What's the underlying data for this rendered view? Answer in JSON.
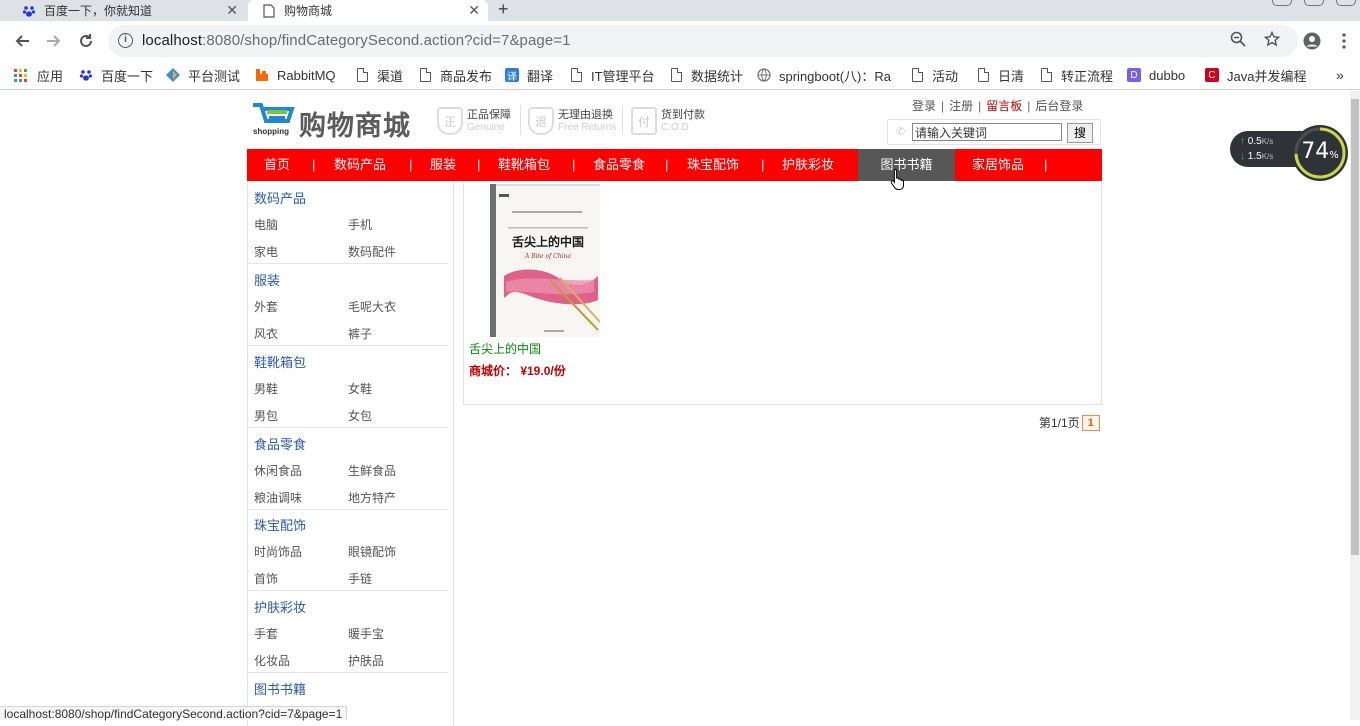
{
  "browser": {
    "tabs": [
      {
        "title": "百度一下，你就知道",
        "active": false
      },
      {
        "title": "购物商城",
        "active": true
      }
    ],
    "url_host": "localhost",
    "url_path": ":8080/shop/findCategorySecond.action?cid=7&page=1",
    "bookmarks": [
      "应用",
      "百度一下",
      "平台测试",
      "RabbitMQ",
      "渠道",
      "商品发布",
      "翻译",
      "IT管理平台",
      "数据统计",
      "springboot(八)：Ra",
      "活动",
      "日清",
      "转正流程",
      "dubbo",
      "Java并发编程"
    ],
    "status_url": "localhost:8080/shop/findCategorySecond.action?cid=7&page=1"
  },
  "header": {
    "logo_title": "购物商城",
    "logo_sub": "shopping",
    "promises": [
      {
        "title": "正品保障",
        "sub": "Genuine",
        "icon": "正"
      },
      {
        "title": "无理由退换",
        "sub": "Free Returns",
        "icon": "退"
      },
      {
        "title": "货到付款",
        "sub": "C.O.D",
        "icon": "付"
      }
    ],
    "links": {
      "login": "登录",
      "register": "注册",
      "guestbook": "留言板",
      "admin": "后台登录",
      "sep": "|"
    },
    "search": {
      "value": "请输入关键词",
      "button": "搜"
    }
  },
  "nav": {
    "items": [
      "首页",
      "数码产品",
      "服装",
      "鞋靴箱包",
      "食品零食",
      "珠宝配饰",
      "护肤彩妆",
      "图书书籍",
      "家居饰品"
    ],
    "active": "图书书籍",
    "pipe": "|"
  },
  "sidebar": {
    "categories": [
      {
        "title": "数码产品",
        "items": [
          "电脑",
          "手机",
          "家电",
          "数码配件"
        ]
      },
      {
        "title": "服装",
        "items": [
          "外套",
          "毛呢大衣",
          "风衣",
          "裤子"
        ]
      },
      {
        "title": "鞋靴箱包",
        "items": [
          "男鞋",
          "女鞋",
          "男包",
          "女包"
        ]
      },
      {
        "title": "食品零食",
        "items": [
          "休闲食品",
          "生鲜食品",
          "粮油调味",
          "地方特产"
        ]
      },
      {
        "title": "珠宝配饰",
        "items": [
          "时尚饰品",
          "眼镜配饰",
          "首饰",
          "手链"
        ]
      },
      {
        "title": "护肤彩妆",
        "items": [
          "手套",
          "暖手宝",
          "化妆品",
          "护肤品"
        ]
      },
      {
        "title": "图书书籍",
        "items": []
      }
    ]
  },
  "product": {
    "name": "舌尖上的中国",
    "price": "商城价： ¥19.0/份",
    "cover_title": "舌尖上的中国",
    "cover_sub": "A Bite of China"
  },
  "pager": {
    "text": "第1/1页",
    "current": "1"
  },
  "netmon": {
    "up": "0.5",
    "down": "1.5",
    "unit": "K/s",
    "percent": "74",
    "pct_sign": "%"
  },
  "colors": {
    "nav_red": "#ff0000",
    "nav_active": "#575757",
    "category_blue": "#2a5caa",
    "price_red": "#c40000",
    "product_green": "#0a8a0a"
  }
}
